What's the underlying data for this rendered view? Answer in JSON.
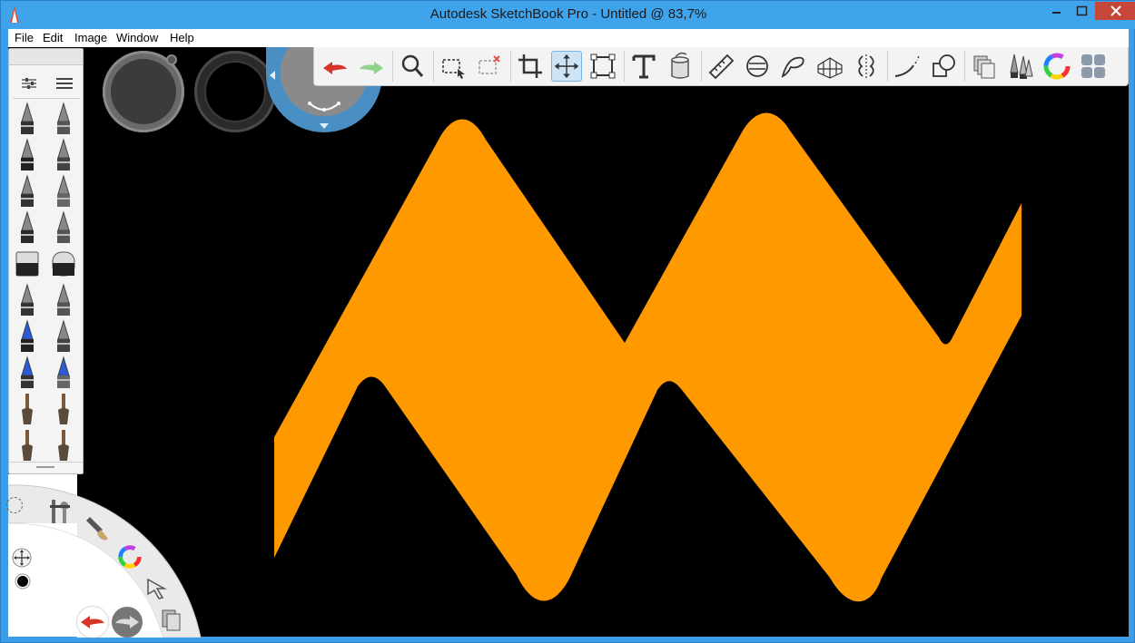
{
  "window": {
    "title": "Autodesk SketchBook Pro - Untitled @ 83,7%",
    "controls": [
      "minimize-icon",
      "maximize-icon",
      "close-icon"
    ]
  },
  "menu": {
    "items": [
      "File",
      "Edit",
      "Image",
      "Window",
      "Help"
    ]
  },
  "toolbar": {
    "tools": [
      "undo-icon",
      "redo-icon",
      "zoom-icon",
      "rectangle-select-icon",
      "clear-select-icon",
      "crop-icon",
      "move-icon",
      "distort-icon",
      "text-icon",
      "fill-icon",
      "ruler-icon",
      "ellipse-icon",
      "french-curve-icon",
      "perspective-icon",
      "symmetry-icon",
      "stroke-icon",
      "shape-icon",
      "layers-icon",
      "brushes-icon",
      "color-wheel-icon",
      "copic-library-icon"
    ],
    "active_tool": "move-icon"
  },
  "brush_palette": {
    "brushes": [
      "pencil",
      "ballpoint-pen",
      "marker",
      "chisel-marker",
      "inking-pen",
      "fine-brush",
      "airbrush",
      "fineliner",
      "eraser-hard",
      "eraser-soft",
      "felt-tip-blunt",
      "felt-tip-pointed",
      "blue-marker",
      "graphite",
      "blue-chisel",
      "ink-bottle",
      "round-brush",
      "fan-brush",
      "flat-brush",
      "dry-brush"
    ]
  },
  "lagoon": {
    "items": [
      "tools-icon",
      "brush-icon",
      "color-wheel-icon",
      "select-icon",
      "layers-icon"
    ]
  },
  "canvas": {
    "background": "#000000",
    "shape_fill": "#ff9900"
  },
  "colors": {
    "titlebar": "#3fa4ec",
    "accent": "#3c9ee8",
    "close": "#c7463a",
    "shape": "#ff9900"
  }
}
